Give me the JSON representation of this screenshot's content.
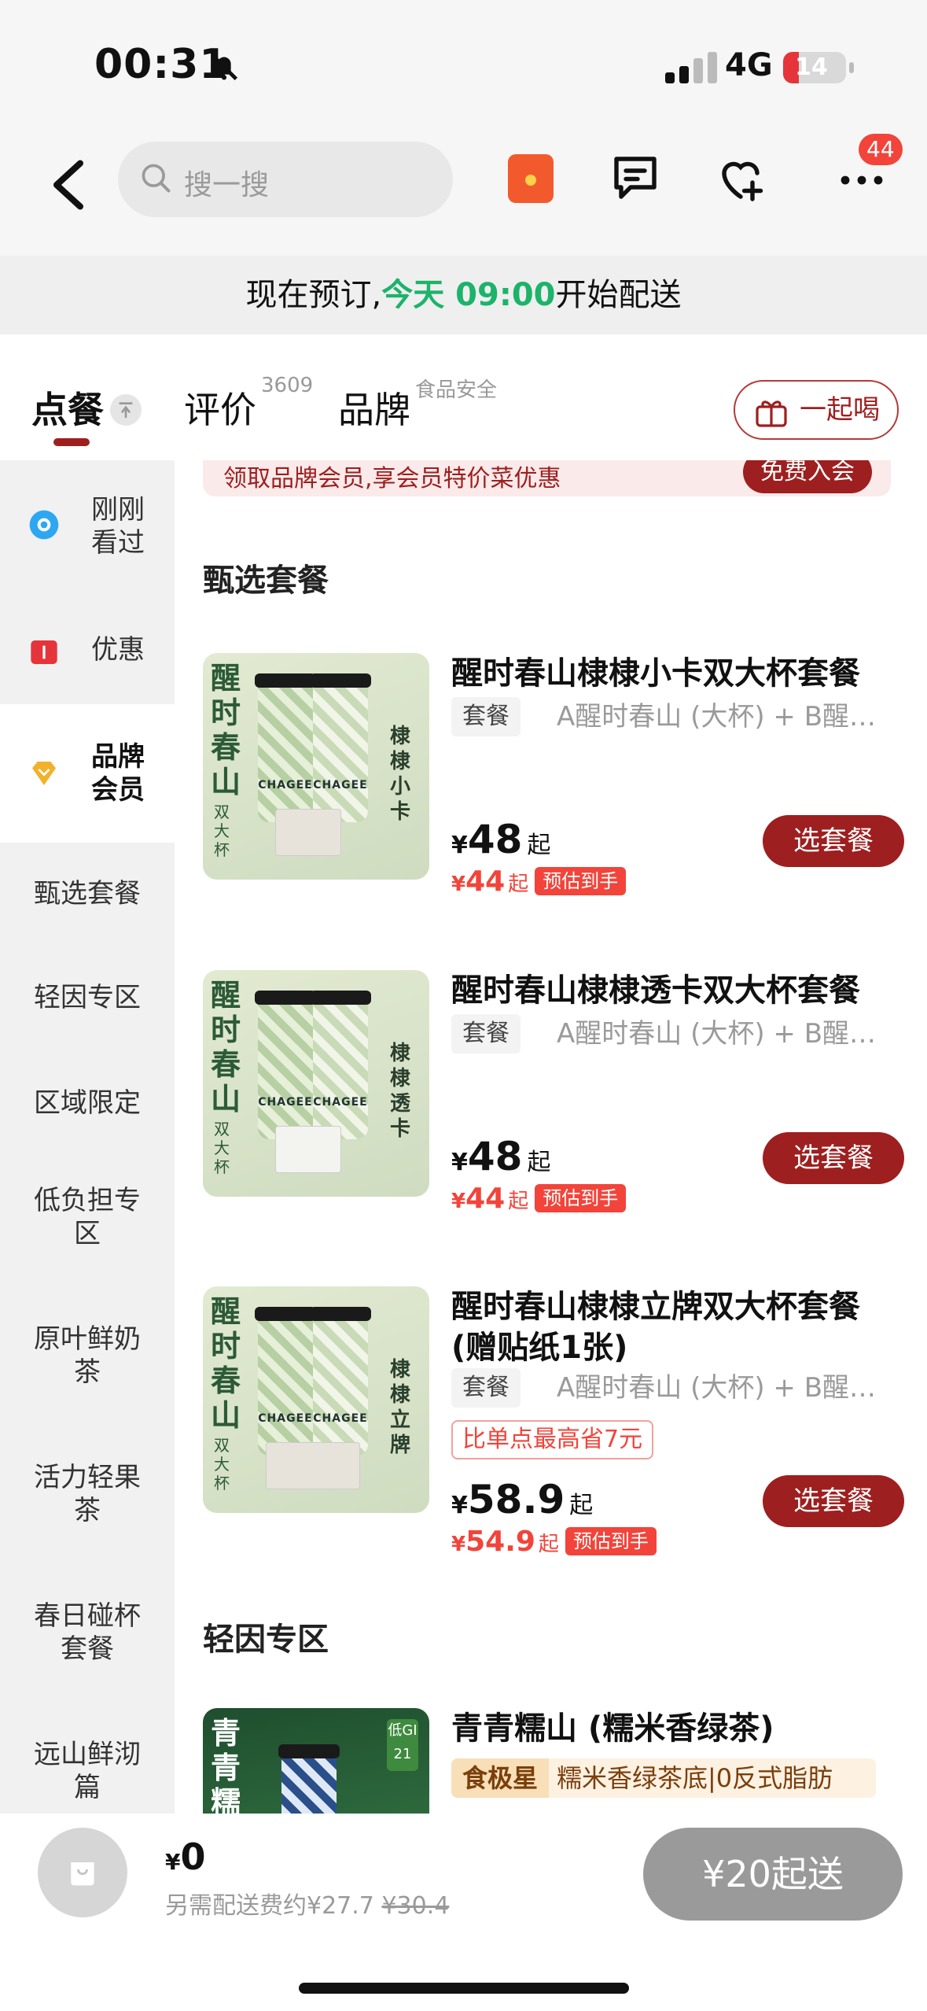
{
  "status": {
    "time": "00:31",
    "network": "4G",
    "battery": "14"
  },
  "header": {
    "search_placeholder": "搜一搜",
    "more_badge": "44"
  },
  "notice": {
    "prefix": "现在预订,",
    "time": "今天 09:00",
    "suffix": "开始配送"
  },
  "tabs": [
    {
      "label": "点餐",
      "active": true
    },
    {
      "label": "评价",
      "count": "3609"
    },
    {
      "label": "品牌",
      "sub": "食品安全"
    }
  ],
  "together_label": "一起喝",
  "sidebar": {
    "recent": "刚刚看过",
    "discount": "优惠",
    "member": "品牌会员",
    "items": [
      "甄选套餐",
      "轻因专区",
      "区域限定",
      "低负担专区",
      "原叶鲜奶茶",
      "活力轻果茶",
      "春日碰杯套餐",
      "远山鲜沏篇"
    ]
  },
  "member_banner": {
    "text": "领取品牌会员,享会员特价菜优惠",
    "button": "免费入会"
  },
  "sections": [
    {
      "title": "甄选套餐",
      "products": [
        {
          "name": "醒时春山棣棣小卡双大杯套餐",
          "tag": "套餐",
          "desc": "A醒时春山 (大杯) + B醒时…",
          "price": "48",
          "after": "44",
          "est": "预估到手",
          "button": "选套餐",
          "thumb_title": "醒时春山",
          "thumb_sub": "双大杯",
          "thumb_right": "棣棣小卡"
        },
        {
          "name": "醒时春山棣棣透卡双大杯套餐",
          "tag": "套餐",
          "desc": "A醒时春山 (大杯) + B醒时…",
          "price": "48",
          "after": "44",
          "est": "预估到手",
          "button": "选套餐",
          "thumb_title": "醒时春山",
          "thumb_sub": "双大杯",
          "thumb_right": "棣棣透卡"
        },
        {
          "name": "醒时春山棣棣立牌双大杯套餐 (赠贴纸1张)",
          "tag": "套餐",
          "desc": "A醒时春山 (大杯) + B醒时…",
          "save": "比单点最高省7元",
          "price": "58.9",
          "after": "54.9",
          "est": "预估到手",
          "button": "选套餐",
          "thumb_title": "醒时春山",
          "thumb_sub": "双大杯",
          "thumb_right": "棣棣立牌"
        }
      ]
    },
    {
      "title": "轻因专区",
      "products": [
        {
          "name": "青青糯山 (糯米香绿茶)",
          "star": "食极星",
          "star_desc": "糯米香绿茶底|0反式脂肪",
          "thumb_title": "青青糯山",
          "thumb_badge": "低GI 21"
        }
      ]
    }
  ],
  "common": {
    "currency": "¥",
    "from": "起"
  },
  "bottom": {
    "amount": "0",
    "fee_text": "另需配送费约¥27.7",
    "fee_orig": "¥30.4",
    "min_order": "¥20起送"
  },
  "colors": {
    "brand": "#9e1f1f",
    "accent_red": "#f2443a",
    "green": "#1cb36a"
  }
}
